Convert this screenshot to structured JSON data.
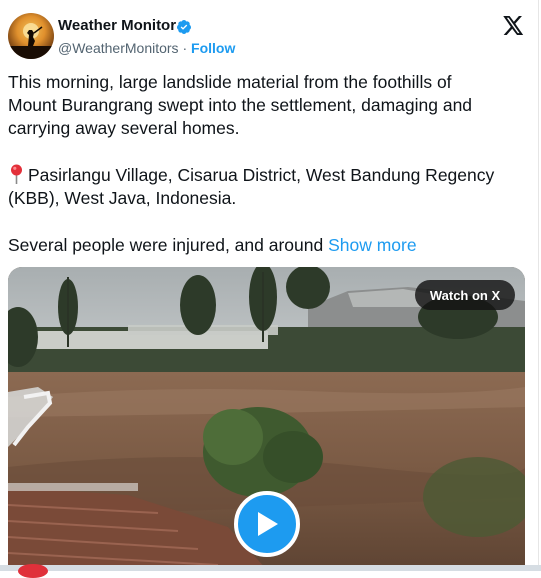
{
  "author": {
    "name": "Weather Monitor",
    "handle": "@WeatherMonitors",
    "separator": "·",
    "follow_label": "Follow"
  },
  "tweet": {
    "paragraph1_line1": "This morning, large landslide material from the foothills of",
    "paragraph1_line2": "Mount Burangrang swept into the settlement, damaging and",
    "paragraph1_line3": "carrying away several homes.",
    "location_line1": "Pasirlangu Village, Cisarua District, West Bandung Regency",
    "location_line2": "(KBB), West Java, Indonesia.",
    "paragraph3": "Several people were injured, and around",
    "show_more_label": "Show more"
  },
  "media": {
    "watch_label": "Watch on X"
  },
  "icons": {
    "verified": "verified-badge-icon",
    "x_logo": "x-logo-icon",
    "pin": "round-pushpin-icon",
    "play": "play-icon"
  },
  "colors": {
    "accent": "#1d9bf0",
    "text": "#0f1419",
    "secondary": "#536471"
  }
}
